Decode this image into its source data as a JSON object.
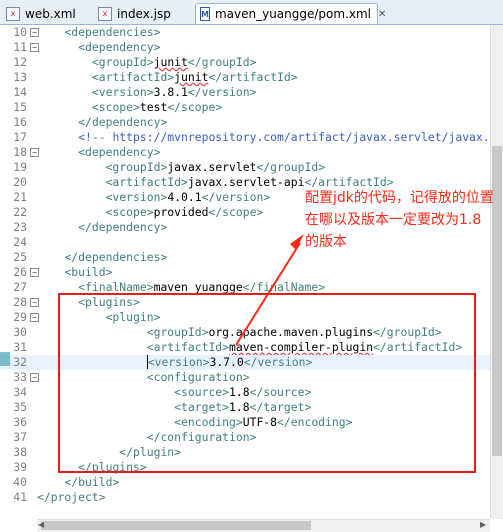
{
  "tabs": [
    {
      "label": "web.xml",
      "icon": "xml-file-icon"
    },
    {
      "label": "index.jsp",
      "icon": "jsp-file-icon"
    },
    {
      "label": "maven_yuangge/pom.xml",
      "icon": "maven-pom-icon",
      "active": true
    }
  ],
  "code_lines": [
    {
      "n": "10",
      "fold": "minus",
      "segs": [
        [
          "i",
          "    "
        ],
        [
          "t",
          "<dependencies>"
        ]
      ]
    },
    {
      "n": "11",
      "fold": "minus",
      "segs": [
        [
          "i",
          "      "
        ],
        [
          "t",
          "<dependency>"
        ]
      ]
    },
    {
      "n": "12",
      "segs": [
        [
          "i",
          "        "
        ],
        [
          "t",
          "<groupId>"
        ],
        [
          "e",
          "junit"
        ],
        [
          "t",
          "</groupId>"
        ]
      ]
    },
    {
      "n": "13",
      "segs": [
        [
          "i",
          "        "
        ],
        [
          "t",
          "<artifactId>"
        ],
        [
          "e",
          "junit"
        ],
        [
          "t",
          "</artifactId>"
        ]
      ]
    },
    {
      "n": "14",
      "segs": [
        [
          "i",
          "        "
        ],
        [
          "t",
          "<version>"
        ],
        [
          "x",
          "3.8.1"
        ],
        [
          "t",
          "</version>"
        ]
      ]
    },
    {
      "n": "15",
      "segs": [
        [
          "i",
          "        "
        ],
        [
          "t",
          "<scope>"
        ],
        [
          "x",
          "test"
        ],
        [
          "t",
          "</scope>"
        ]
      ]
    },
    {
      "n": "16",
      "segs": [
        [
          "i",
          "      "
        ],
        [
          "t",
          "</dependency>"
        ]
      ]
    },
    {
      "n": "17",
      "segs": [
        [
          "i",
          "      "
        ],
        [
          "c",
          "<!-- https://mvnrepository.com/artifact/javax.servlet/javax.s"
        ]
      ]
    },
    {
      "n": "18",
      "fold": "minus",
      "segs": [
        [
          "i",
          "      "
        ],
        [
          "t",
          "<dependency>"
        ]
      ]
    },
    {
      "n": "19",
      "segs": [
        [
          "i",
          "          "
        ],
        [
          "t",
          "<groupId>"
        ],
        [
          "x",
          "javax.servlet"
        ],
        [
          "t",
          "</groupId>"
        ]
      ]
    },
    {
      "n": "20",
      "segs": [
        [
          "i",
          "          "
        ],
        [
          "t",
          "<artifactId>"
        ],
        [
          "x",
          "javax.servlet-api"
        ],
        [
          "t",
          "</artifactId>"
        ]
      ]
    },
    {
      "n": "21",
      "segs": [
        [
          "i",
          "          "
        ],
        [
          "t",
          "<version>"
        ],
        [
          "x",
          "4.0.1"
        ],
        [
          "t",
          "</version>"
        ]
      ]
    },
    {
      "n": "22",
      "segs": [
        [
          "i",
          "          "
        ],
        [
          "t",
          "<scope>"
        ],
        [
          "x",
          "provided"
        ],
        [
          "t",
          "</scope>"
        ]
      ]
    },
    {
      "n": "23",
      "segs": [
        [
          "i",
          "      "
        ],
        [
          "t",
          "</dependency>"
        ]
      ]
    },
    {
      "n": "24",
      "segs": [
        [
          "i",
          ""
        ]
      ]
    },
    {
      "n": "25",
      "segs": [
        [
          "i",
          "    "
        ],
        [
          "t",
          "</dependencies>"
        ]
      ]
    },
    {
      "n": "26",
      "fold": "minus",
      "segs": [
        [
          "i",
          "    "
        ],
        [
          "t",
          "<build>"
        ]
      ]
    },
    {
      "n": "27",
      "segs": [
        [
          "i",
          "      "
        ],
        [
          "t",
          "<finalName>"
        ],
        [
          "x",
          "maven_yuangge"
        ],
        [
          "t",
          "</finalName>"
        ]
      ]
    },
    {
      "n": "28",
      "fold": "minus",
      "segs": [
        [
          "i",
          "      "
        ],
        [
          "t",
          "<plugins>"
        ]
      ]
    },
    {
      "n": "29",
      "fold": "minus",
      "segs": [
        [
          "i",
          "          "
        ],
        [
          "t",
          "<plugin>"
        ]
      ]
    },
    {
      "n": "30",
      "segs": [
        [
          "i",
          "                "
        ],
        [
          "t",
          "<groupId>"
        ],
        [
          "x",
          "org.apache.maven.plugins"
        ],
        [
          "t",
          "</groupId>"
        ]
      ]
    },
    {
      "n": "31",
      "segs": [
        [
          "i",
          "                "
        ],
        [
          "t",
          "<artifactId>"
        ],
        [
          "e",
          "maven-compiler-plugin"
        ],
        [
          "t",
          "</artifactId>"
        ]
      ]
    },
    {
      "n": "32",
      "current": true,
      "segs": [
        [
          "i",
          "                "
        ],
        [
          "t",
          "<version>"
        ],
        [
          "x",
          "3.7.0"
        ],
        [
          "t",
          "</version>"
        ]
      ]
    },
    {
      "n": "33",
      "fold": "minus",
      "segs": [
        [
          "i",
          "                "
        ],
        [
          "t",
          "<configuration>"
        ]
      ]
    },
    {
      "n": "34",
      "segs": [
        [
          "i",
          "                    "
        ],
        [
          "t",
          "<source>"
        ],
        [
          "x",
          "1.8"
        ],
        [
          "t",
          "</source>"
        ]
      ]
    },
    {
      "n": "35",
      "segs": [
        [
          "i",
          "                    "
        ],
        [
          "t",
          "<target>"
        ],
        [
          "x",
          "1.8"
        ],
        [
          "t",
          "</target>"
        ]
      ]
    },
    {
      "n": "36",
      "segs": [
        [
          "i",
          "                    "
        ],
        [
          "t",
          "<encoding>"
        ],
        [
          "x",
          "UTF-8"
        ],
        [
          "t",
          "</encoding>"
        ]
      ]
    },
    {
      "n": "37",
      "segs": [
        [
          "i",
          "                "
        ],
        [
          "t",
          "</configuration>"
        ]
      ]
    },
    {
      "n": "38",
      "segs": [
        [
          "i",
          "            "
        ],
        [
          "t",
          "</plugin>"
        ]
      ]
    },
    {
      "n": "39",
      "segs": [
        [
          "i",
          "      "
        ],
        [
          "t",
          "</plugins>"
        ]
      ]
    },
    {
      "n": "40",
      "segs": [
        [
          "i",
          "    "
        ],
        [
          "t",
          "</build>"
        ]
      ]
    },
    {
      "n": "41",
      "segs": [
        [
          "i",
          ""
        ],
        [
          "t",
          "</project>"
        ]
      ]
    }
  ],
  "annotation": {
    "text": "配置jdk的代码，记得放的位置在哪以及版本一定要改为1.8的版本",
    "color": "#ff2a1a"
  },
  "colors": {
    "tag": "#3f7f7f",
    "comment": "#3f5fbf",
    "highlight_box": "#e02020",
    "current_line": "#e8f2fe"
  }
}
